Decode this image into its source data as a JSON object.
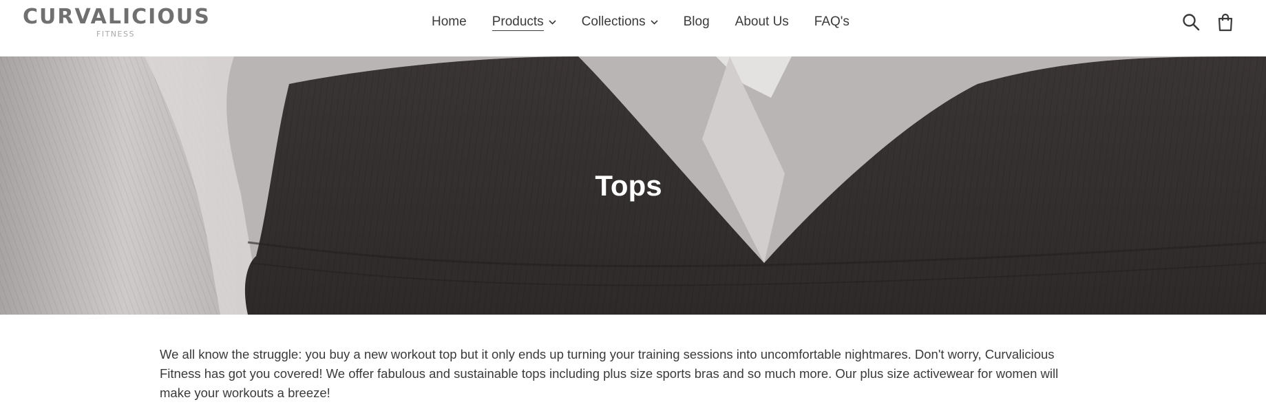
{
  "brand": {
    "name": "CURVALICIOUS",
    "tagline": "FITNESS"
  },
  "nav": {
    "items": [
      {
        "label": "Home",
        "has_dropdown": false,
        "active": false
      },
      {
        "label": "Products",
        "has_dropdown": true,
        "active": true
      },
      {
        "label": "Collections",
        "has_dropdown": true,
        "active": false
      },
      {
        "label": "Blog",
        "has_dropdown": false,
        "active": false
      },
      {
        "label": "About Us",
        "has_dropdown": false,
        "active": false
      },
      {
        "label": "FAQ's",
        "has_dropdown": false,
        "active": false
      }
    ]
  },
  "header_icons": [
    "search-icon",
    "cart-icon"
  ],
  "hero": {
    "title": "Tops"
  },
  "collection": {
    "description": "We all know the struggle: you buy a new workout top but it only ends up turning your training sessions into uncomfortable nightmares. Don't worry, Curvalicious Fitness has got you covered! We offer fabulous and sustainable tops including plus size sports bras and so much more. Our plus size activewear for women will make your workouts a breeze!"
  },
  "colors": {
    "text": "#3a3a3a",
    "logo": "#707070",
    "hero_dark": "#3d3838",
    "hero_light": "#b8b3b3"
  }
}
